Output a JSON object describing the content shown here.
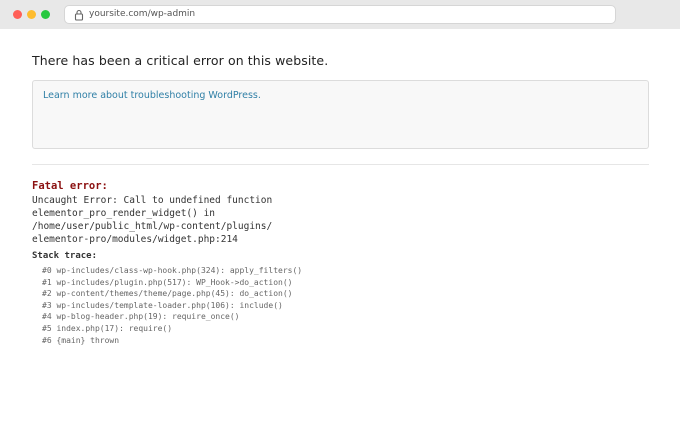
{
  "browser": {
    "url": "yoursite.com/wp-admin",
    "colors": {
      "close": "#ff5f57",
      "minimize": "#febc2e",
      "maximize": "#28c840"
    }
  },
  "page": {
    "headline": "There has been a critical error on this website.",
    "info_link": "Learn more about troubleshooting WordPress.",
    "error": {
      "label": "Fatal error:",
      "message_lines": [
        "Uncaught Error: Call to undefined function",
        "elementor_pro_render_widget() in",
        "/home/user/public_html/wp-content/plugins/",
        "elementor-pro/modules/widget.php:214"
      ]
    },
    "stack": {
      "label": "Stack trace:",
      "frames": [
        "#0 wp-includes/class-wp-hook.php(324): apply_filters()",
        "#1 wp-includes/plugin.php(517): WP_Hook->do_action()",
        "#2 wp-content/themes/theme/page.php(45): do_action()",
        "#3 wp-includes/template-loader.php(106): include()",
        "#4 wp-blog-header.php(19): require_once()",
        "#5 index.php(17): require()",
        "#6 {main} thrown"
      ]
    }
  }
}
